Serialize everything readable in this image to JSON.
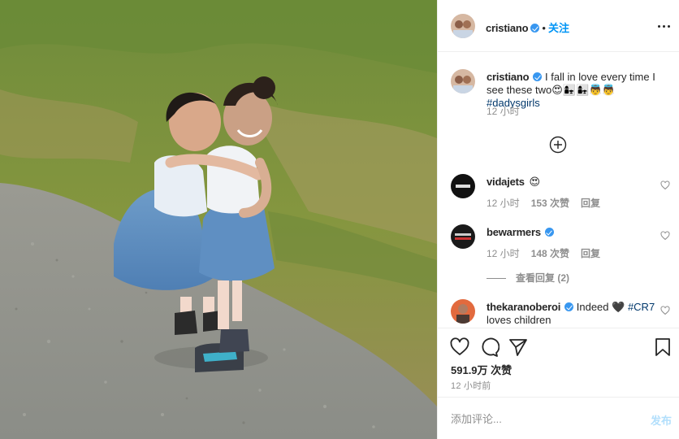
{
  "post": {
    "image_alt": "Two little girls in blue tulle dresses hugging on a gravel path beside grass",
    "header": {
      "username": "cristiano",
      "separator": "•",
      "follow_label": "关注"
    },
    "caption": {
      "username": "cristiano",
      "text": "I fall in love every time I see these two😍👩‍👧👩‍👧👼👼",
      "hashtag": "#dadysgirls",
      "time": "12 小时"
    },
    "comments": [
      {
        "username": "vidajets",
        "verified": false,
        "text": "😍",
        "time": "12 小时",
        "likes": "153 次赞",
        "reply_label": "回复"
      },
      {
        "username": "bewarmers",
        "verified": true,
        "text": "",
        "time": "12 小时",
        "likes": "148 次赞",
        "reply_label": "回复",
        "view_replies": "查看回复 (2)"
      },
      {
        "username": "thekaranoberoi",
        "verified": true,
        "text": "Indeed 🖤",
        "hashtag": "#CR7",
        "text2": "loves children"
      }
    ],
    "likes": "591.9万 次赞",
    "time_ago": "12 小时前",
    "add_comment_placeholder": "添加评论...",
    "post_label": "发布"
  },
  "icons": {
    "more": "more-options-icon",
    "load_more": "plus-circle-icon",
    "like": "heart-icon",
    "comment": "comment-icon",
    "share": "share-icon",
    "save": "bookmark-icon"
  },
  "colors": {
    "accent": "#0095f6",
    "verified": "#3897f0",
    "post_disabled": "#b2dffc",
    "muted": "#8e8e8e"
  }
}
